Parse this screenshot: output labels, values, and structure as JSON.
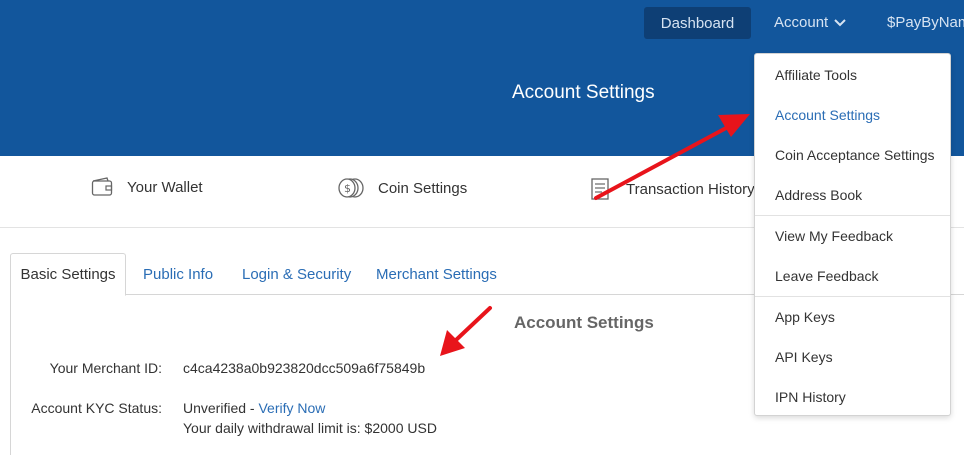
{
  "header": {
    "dashboard_label": "Dashboard",
    "account_label": "Account",
    "pay_label": "$PayByNam",
    "title": "Account Settings"
  },
  "nav": {
    "wallet": "Your Wallet",
    "coin_settings": "Coin Settings",
    "transaction_history": "Transaction History"
  },
  "tabs": [
    {
      "label": "Basic Settings",
      "active": true
    },
    {
      "label": "Public Info"
    },
    {
      "label": "Login & Security"
    },
    {
      "label": "Merchant Settings"
    }
  ],
  "panel": {
    "title": "Account Settings",
    "merchant_id_label": "Your Merchant ID:",
    "merchant_id_value": "c4ca4238a0b923820dcc509a6f75849b",
    "kyc_label": "Account KYC Status:",
    "kyc_status": "Unverified - ",
    "kyc_link": "Verify Now",
    "withdraw_limit": "Your daily withdrawal limit is: $2000 USD"
  },
  "dropdown": {
    "items": [
      "Affiliate Tools",
      "Account Settings",
      "Coin Acceptance Settings",
      "Address Book",
      "View My Feedback",
      "Leave Feedback",
      "App Keys",
      "API Keys",
      "IPN History"
    ],
    "active_index": 1
  },
  "colors": {
    "header_bg": "#12569c",
    "accent_link": "#2a6db5",
    "annotation_arrow": "#e8141b"
  }
}
